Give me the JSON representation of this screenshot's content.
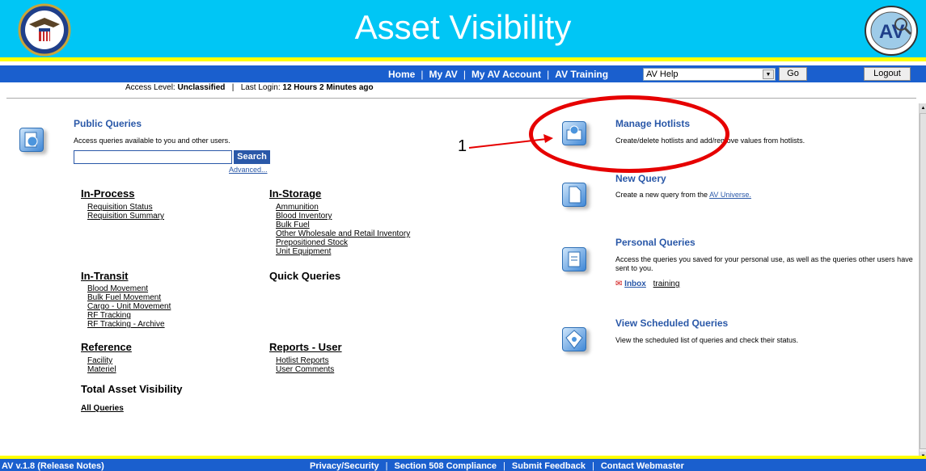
{
  "header": {
    "title": "Asset Visibility",
    "bg_color": "#00c6f5",
    "accent_color": "#ffff00",
    "logo_left": "dla-eagle-seal-logo",
    "logo_right": "av-globe-logo"
  },
  "nav": {
    "links": [
      "Home",
      "My AV",
      "My AV Account",
      "AV Training"
    ],
    "help_selected": "AV Help",
    "go_label": "Go",
    "logout_label": "Logout",
    "bar_color": "#1a5fce"
  },
  "access": {
    "level_label": "Access Level:",
    "level_value": "Unclassified",
    "last_login_label": "Last Login:",
    "last_login_value": "12 Hours 2 Minutes ago"
  },
  "public_queries": {
    "title": "Public Queries",
    "description": "Access queries available to you and other users.",
    "search_value": "",
    "search_label": "Search",
    "advanced_label": "Advanced..."
  },
  "categories": {
    "in_process": {
      "title": "In-Process",
      "items": [
        "Requisition Status",
        "Requisition Summary"
      ]
    },
    "in_storage": {
      "title": "In-Storage",
      "items": [
        "Ammunition",
        "Blood Inventory",
        "Bulk Fuel",
        "Other Wholesale and Retail Inventory",
        "Prepositioned Stock",
        "Unit Equipment"
      ]
    },
    "in_transit": {
      "title": "In-Transit",
      "items": [
        "Blood Movement",
        "Bulk Fuel Movement",
        "Cargo - Unit Movement",
        "RF Tracking",
        "RF Tracking - Archive"
      ]
    },
    "quick_queries": {
      "title": "Quick Queries"
    },
    "reference": {
      "title": "Reference",
      "items": [
        "Facility",
        "Materiel"
      ]
    },
    "reports_user": {
      "title": "Reports - User",
      "items": [
        "Hotlist Reports",
        "User Comments"
      ]
    },
    "total_av": {
      "title": "Total Asset Visibility"
    },
    "all_queries": "All Queries"
  },
  "right": {
    "hotlists": {
      "title": "Manage Hotlists",
      "description": "Create/delete hotlists and add/remove values from hotlists."
    },
    "new_query": {
      "title": "New Query",
      "description": "Create a new query from the ",
      "link": "AV Universe."
    },
    "personal": {
      "title": "Personal Queries",
      "description": "Access the queries you saved for your personal use, as well as the queries other users have sent to you.",
      "inbox": "Inbox",
      "training": "training"
    },
    "scheduled": {
      "title": "View Scheduled Queries",
      "description": "View the scheduled list of queries and check their status."
    }
  },
  "annotation": {
    "number": "1",
    "color": "#e60000"
  },
  "footer": {
    "version": "AV v.1.8 (Release Notes)",
    "links": [
      "Privacy/Security",
      "Section 508 Compliance",
      "Submit Feedback",
      "Contact Webmaster"
    ]
  }
}
